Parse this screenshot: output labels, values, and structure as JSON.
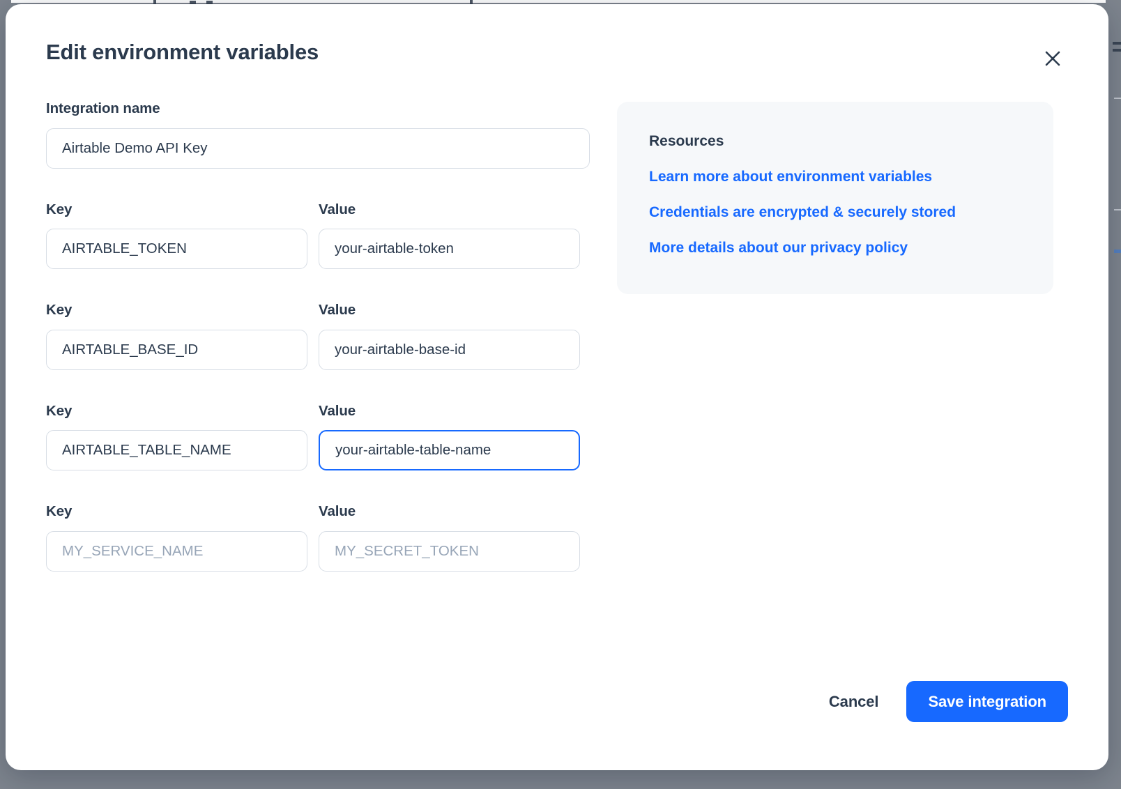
{
  "modal": {
    "title": "Edit environment variables",
    "close_icon": "close-icon"
  },
  "form": {
    "name_label": "Integration name",
    "name_value": "Airtable Demo API Key",
    "name_placeholder": "Integration name",
    "key_label": "Key",
    "value_label": "Value",
    "rows": [
      {
        "key_label": "Key",
        "value_label": "Value",
        "key_value": "AIRTABLE_TOKEN",
        "value_value": "your-airtable-token",
        "key_placeholder": "MY_SERVICE_NAME",
        "value_placeholder": "MY_SECRET_TOKEN",
        "focused": "none"
      },
      {
        "key_label": "Key",
        "value_label": "Value",
        "key_value": "AIRTABLE_BASE_ID",
        "value_value": "your-airtable-base-id",
        "key_placeholder": "MY_SERVICE_NAME",
        "value_placeholder": "MY_SECRET_TOKEN",
        "focused": "none"
      },
      {
        "key_label": "Key",
        "value_label": "Value",
        "key_value": "AIRTABLE_TABLE_NAME",
        "value_value": "your-airtable-table-name",
        "key_placeholder": "MY_SERVICE_NAME",
        "value_placeholder": "MY_SECRET_TOKEN",
        "focused": "value"
      },
      {
        "key_label": "Key",
        "value_label": "Value",
        "key_value": "",
        "value_value": "",
        "key_placeholder": "MY_SERVICE_NAME",
        "value_placeholder": "MY_SECRET_TOKEN",
        "focused": "none"
      }
    ]
  },
  "resources": {
    "title": "Resources",
    "links": [
      "Learn more about environment variables",
      "Credentials are encrypted & securely stored",
      "More details about our privacy policy"
    ]
  },
  "footer": {
    "cancel_label": "Cancel",
    "save_label": "Save integration"
  },
  "colors": {
    "accent": "#1769ff",
    "text": "#2b3a4d",
    "placeholder": "#97a5b7",
    "input_border": "#d7dde5",
    "panel_bg": "#f6f8fa",
    "backdrop": "#7e858e",
    "modal_bg": "#ffffff"
  }
}
